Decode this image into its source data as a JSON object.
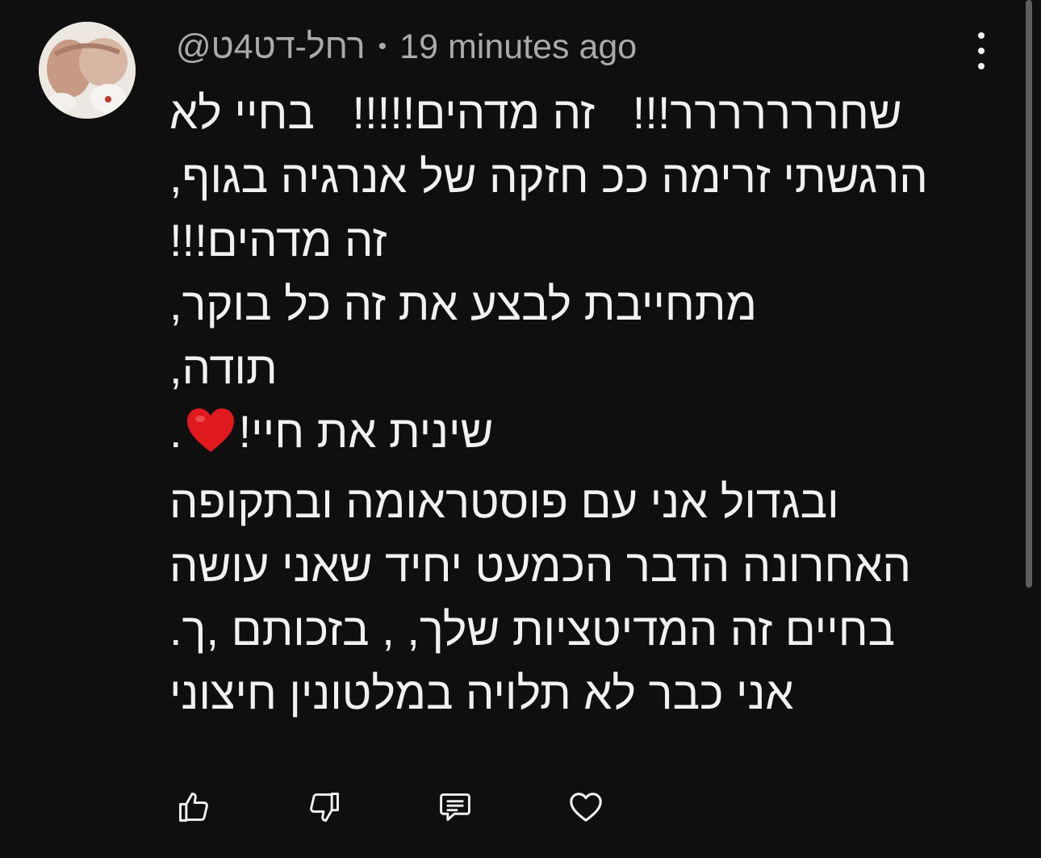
{
  "comment": {
    "author": "@רחל-דט4ט",
    "separator": "•",
    "timestamp": "19 minutes ago",
    "lines": [
      "שחררררררר!!!   זה מדהים!!!!!   בחיי לא",
      "הרגשתי זרימה ככ חזקה של אנרגיה בגוף,",
      "זה מדהים!!!",
      "מתחייבת לבצע את זה כל בוקר,",
      "תודה,",
      "שינית את חיי!",
      "ובגדול אני עם פוסטראומה ובתקופה",
      "האחרונה הדבר הכמעט יחיד שאני עושה",
      "בחיים זה המדיטציות שלך, , בזכותם ,ך.",
      "אני כבר לא תלויה במלטונין חיצוני"
    ],
    "line6_suffix": "."
  },
  "icons": {
    "heart_emoji": "heart-emoji",
    "more": "more-vertical-icon",
    "like": "thumb-up-icon",
    "dislike": "thumb-down-icon",
    "reply": "reply-comment-icon",
    "love": "heart-outline-icon"
  },
  "colors": {
    "background": "#0f0f0f",
    "text": "#f1f1f1",
    "meta": "#aaaaaa",
    "heart": "#e0191f"
  }
}
